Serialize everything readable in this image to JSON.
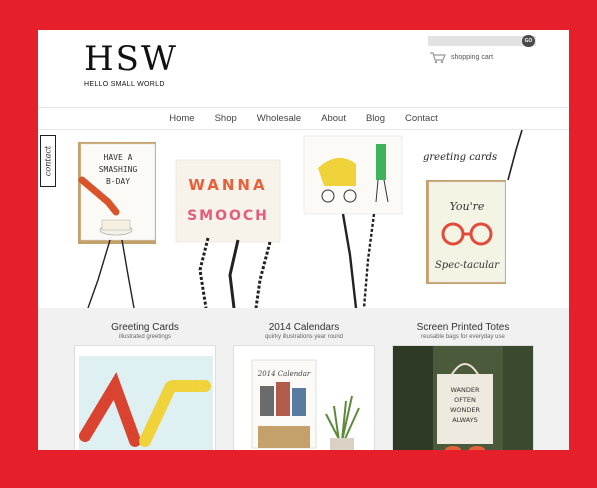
{
  "brand": {
    "letters": "HSW",
    "name": "HELLO SMALL WORLD"
  },
  "search": {
    "placeholder": "",
    "go_label": "GO"
  },
  "cart": {
    "label": "shopping cart",
    "icon": "cart-icon"
  },
  "nav": [
    {
      "label": "Home"
    },
    {
      "label": "Shop"
    },
    {
      "label": "Wholesale"
    },
    {
      "label": "About"
    },
    {
      "label": "Blog"
    },
    {
      "label": "Contact"
    }
  ],
  "banner": {
    "contact_tab": "contact",
    "greeting_label": "greeting cards",
    "cards": [
      {
        "text": "HAVE A SMASHING B-DAY"
      },
      {
        "text": "WANNA SMOOCH"
      },
      {
        "text": ""
      },
      {
        "text": "You're Spec-tacular"
      }
    ]
  },
  "products": [
    {
      "title": "Greeting Cards",
      "subtitle": "illustrated greetings"
    },
    {
      "title": "2014 Calendars",
      "subtitle": "quirky illustrations year round"
    },
    {
      "title": "Screen Printed Totes",
      "subtitle": "reusable bags for everyday use"
    }
  ],
  "calendar_label": "2014 Calendar",
  "tote_text": "WANDER OFTEN WONDER ALWAYS",
  "colors": {
    "frame": "#e5202a",
    "accent": "#f0d23a"
  }
}
